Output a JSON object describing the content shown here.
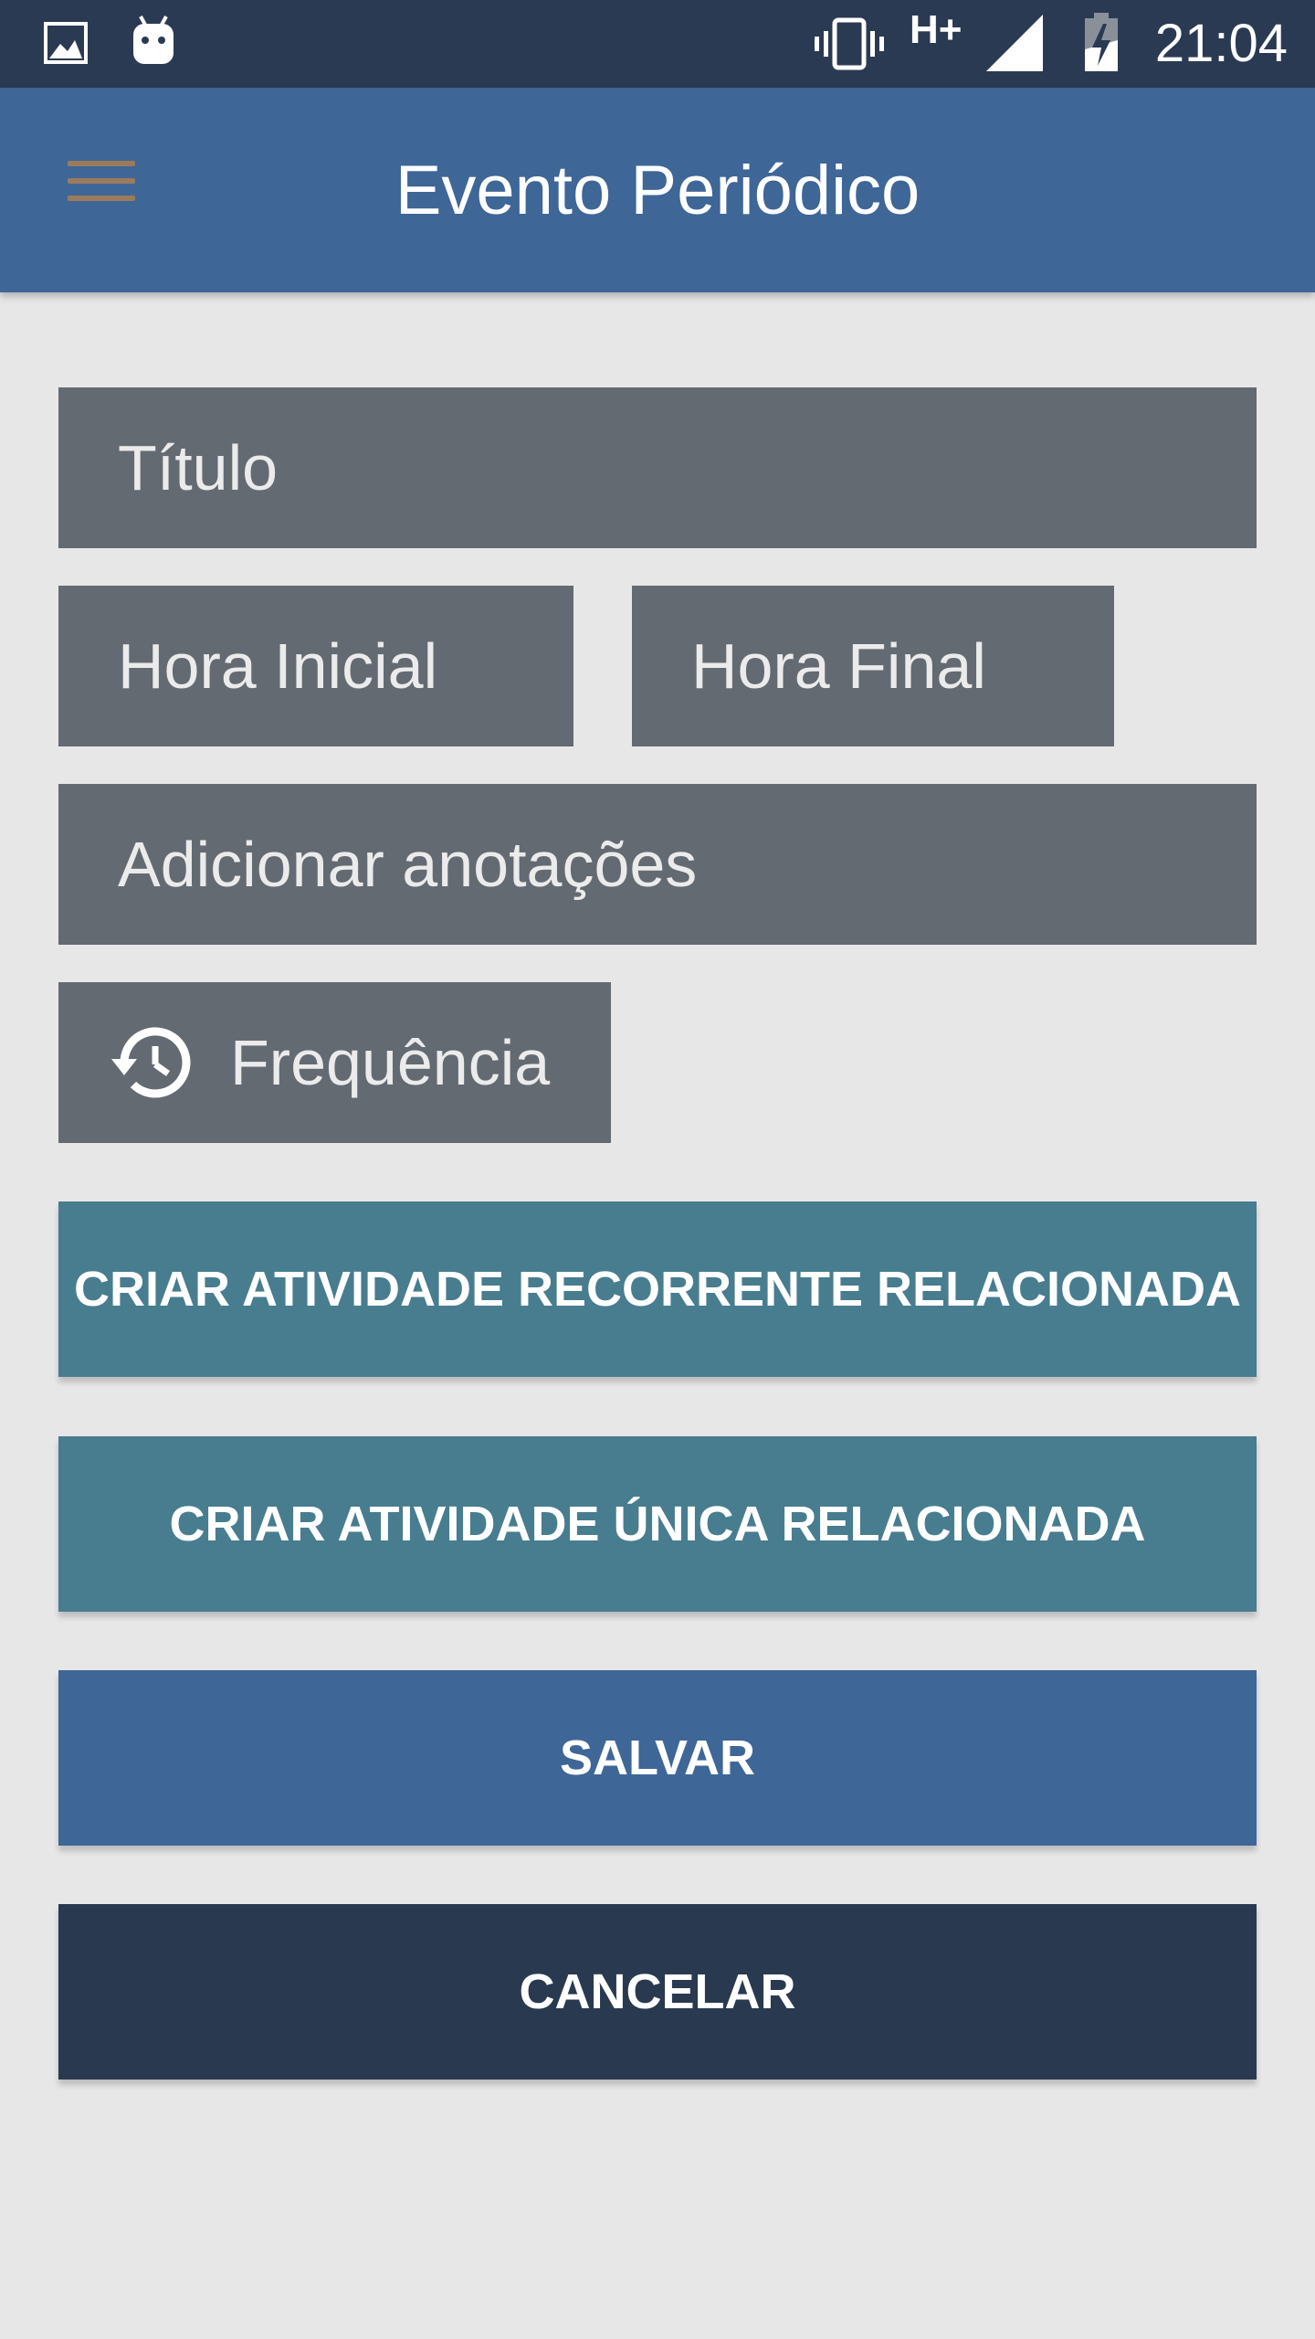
{
  "status_bar": {
    "time": "21:04",
    "network": "H+",
    "icons": [
      "image-icon",
      "android-icon",
      "vibrate-icon",
      "network-type-icon",
      "signal-icon",
      "battery-charging-icon"
    ]
  },
  "app_bar": {
    "title": "Evento Periódico",
    "menu_icon": "menu-icon"
  },
  "form": {
    "titulo_placeholder": "Título",
    "hora_inicial_placeholder": "Hora Inicial",
    "hora_final_placeholder": "Hora Final",
    "anotacoes_placeholder": "Adicionar anotações",
    "frequencia_label": "Frequência",
    "frequencia_icon": "history-icon"
  },
  "buttons": {
    "recorrente": "CRIAR ATIVIDADE RECORRENTE RELACIONADA",
    "unica": "CRIAR ATIVIDADE ÚNICA RELACIONADA",
    "salvar": "SALVAR",
    "cancelar": "CANCELAR"
  },
  "colors": {
    "status_bar": "#2b3a53",
    "app_bar": "#3e6697",
    "field_bg": "#646a72",
    "teal_button": "#477d8f",
    "save_button": "#3e6697",
    "cancel_button": "#29394f",
    "background": "#e8e7e8"
  }
}
